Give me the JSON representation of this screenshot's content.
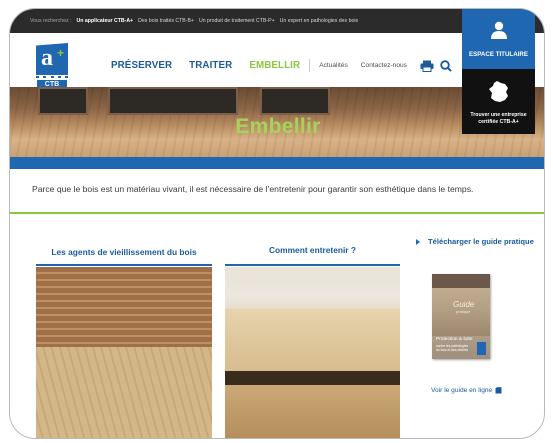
{
  "topbar": {
    "lead": "Vous recherchez :",
    "links": [
      {
        "label": "Un applicateur CTB-A+",
        "active": true
      },
      {
        "label": "Des bois traités CTB-B+",
        "active": false
      },
      {
        "label": "Un produit de traitement CTB-P+",
        "active": false
      },
      {
        "label": "Un expert en pathologies des bois",
        "active": false
      }
    ]
  },
  "logo": {
    "letter": "a",
    "plus": "+",
    "ctb": "CTB"
  },
  "nav": {
    "preserver": "PRÉSERVER",
    "traiter": "TRAITER",
    "embellir": "EMBELLIR",
    "actualites": "Actualités",
    "contact": "Contactez-nous"
  },
  "espace": {
    "label": "ESPACE TITULAIRE"
  },
  "trouver": {
    "label": "Trouver une entreprise certifiée CTB-A+"
  },
  "hero": {
    "title": "Embellir"
  },
  "intro": "Parce que le bois est un matériau vivant, il est nécessaire de l’entretenir pour garantir son esthétique dans le temps.",
  "columns": {
    "left_title": "Les agents de vieillissement du bois",
    "right_title": "Comment entretenir ?"
  },
  "sidebar": {
    "download": "Télécharger le guide pratique",
    "guide_title": "Guide",
    "guide_sub": "pratique",
    "guide_band_title": "Protection & lutte",
    "guide_band_sub": "contre les pathologies du bois et des dérivés",
    "voir": "Voir le guide en ligne"
  },
  "colors": {
    "blue": "#1f67b1",
    "green": "#8dc63f",
    "dark": "#2b2b2b"
  }
}
